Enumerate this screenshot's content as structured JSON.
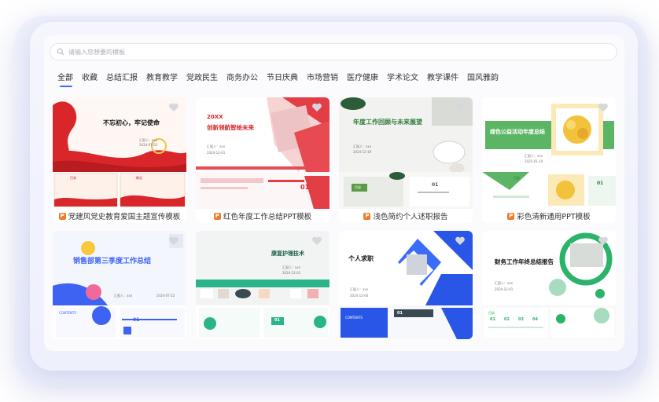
{
  "search": {
    "placeholder": "请输入您想要的模板"
  },
  "tabs": [
    "全部",
    "收藏",
    "总结汇报",
    "教育教学",
    "党政民生",
    "商务办公",
    "节日庆典",
    "市场营销",
    "医疗健康",
    "学术论文",
    "教学课件",
    "国风雅韵"
  ],
  "cards": [
    {
      "caption": "党建风党史教育爱国主题宣传模板",
      "title": "不忘初心，牢记使命",
      "sub1": "汇报人：xxx",
      "sub2": "2024-07-02",
      "tag1": "目录",
      "tag2": "概念"
    },
    {
      "caption": "红色年度工作总结PPT模板",
      "title_top": "20XX",
      "title": "创新领航智绘未来",
      "sub1": "汇报人：xxx",
      "sub2": "2024-12-01",
      "num": "01"
    },
    {
      "caption": "浅色简约个人述职报告",
      "title": "年度工作回顾与未来展望",
      "sub1": "汇报人：xxx",
      "sub2": "2024-12-19",
      "num": "01",
      "tag": "目录"
    },
    {
      "caption": "彩色清新通用PPT模板",
      "title": "绿色公益活动年度总结",
      "sub1": "汇报人：xxx",
      "sub2": "2025-01-10",
      "num": "01",
      "tag": "目录"
    },
    {
      "caption": "",
      "title": "销售部第三季度工作总结",
      "sub1": "汇报人：xxx",
      "sub2": "2024-07-22",
      "num": "01",
      "tag": "CONTENTS"
    },
    {
      "caption": "",
      "title": "康复护理技术",
      "sub1": "汇报人：xxx",
      "sub2": "2024-12-01",
      "num": "01"
    },
    {
      "caption": "",
      "title": "个人求职",
      "sub1": "汇报人：xxx",
      "sub2": "2024-12-06",
      "num": "01",
      "tag": "CONTENTS"
    },
    {
      "caption": "",
      "title": "财务工作年终总结报告",
      "sub1": "汇报人：xxx",
      "sub2": "2024-12-01",
      "num1": "01",
      "num2": "02",
      "num3": "03",
      "num4": "04",
      "tag": "目录"
    }
  ],
  "colors": {
    "accent": "#3b6cf6",
    "badge": "#f07a2a"
  }
}
